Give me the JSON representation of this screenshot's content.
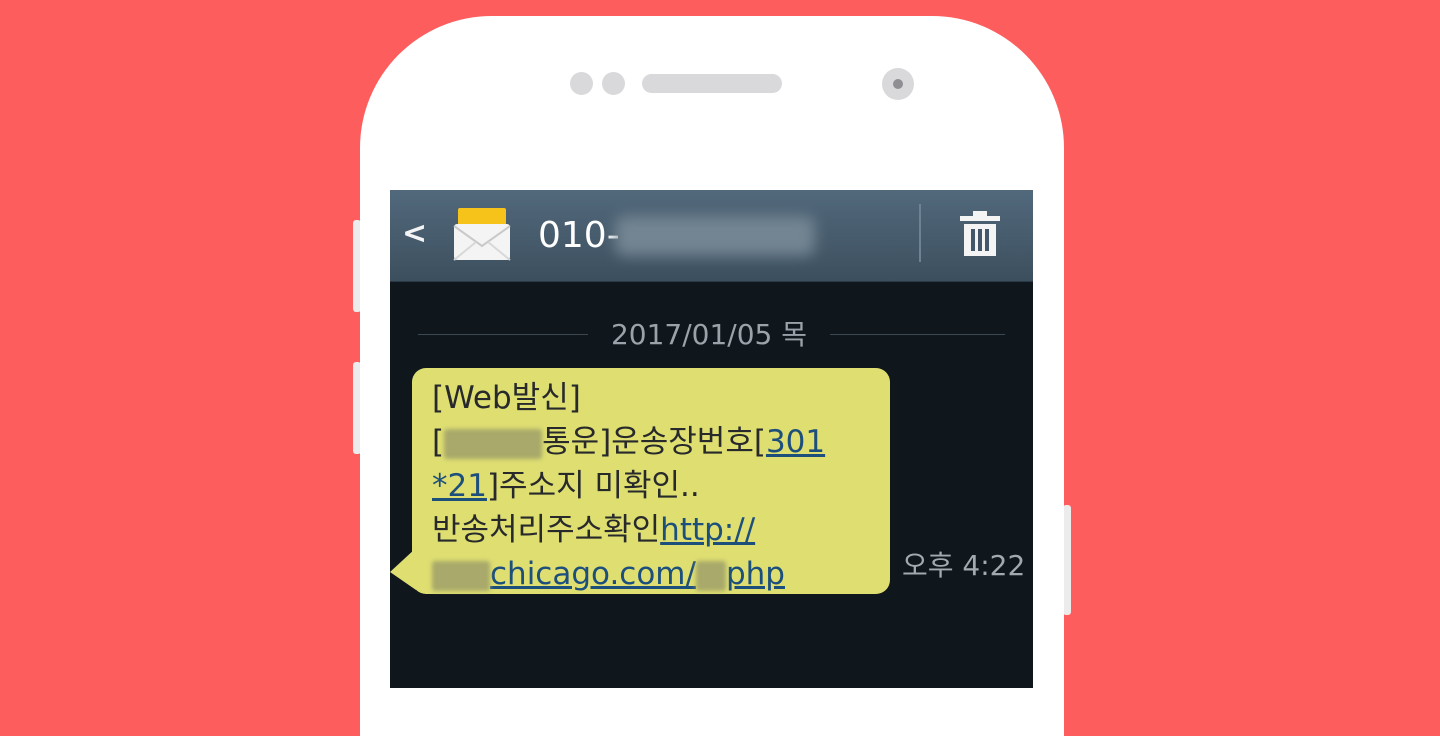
{
  "header": {
    "phone_number": "010-"
  },
  "conversation": {
    "date": "2017/01/05 목"
  },
  "message": {
    "line1": "[Web발신]",
    "line2_prefix": "[",
    "line2_text": "통운]운송장번호[",
    "line2_link": "301",
    "line3_link": "*21",
    "line3_text": "]주소지 미확인..",
    "line4_text": "반송처리주소확인",
    "line4_link": "http://",
    "line5_link_domain": "chicago.com/",
    "line5_link_ext": "php",
    "time": "오후 4:22"
  },
  "colors": {
    "background": "#fe5d5d",
    "screen": "#0f161c",
    "bubble": "#dede71",
    "link": "#1d4f7c"
  },
  "icons": [
    "back-icon",
    "envelope-icon",
    "trash-icon"
  ]
}
